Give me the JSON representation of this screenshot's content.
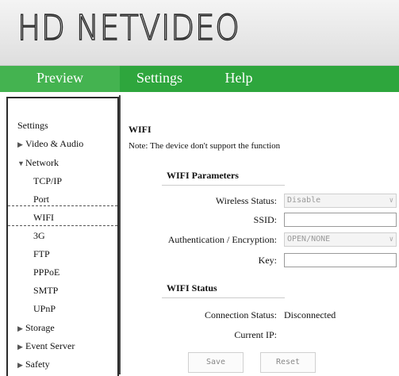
{
  "header": {
    "logo_text": "HD NETVIDEO"
  },
  "nav": {
    "preview": "Preview",
    "settings": "Settings",
    "help": "Help"
  },
  "sidebar": {
    "settings": "Settings",
    "video_audio": "Video & Audio",
    "network": "Network",
    "tcpip": "TCP/IP",
    "port": "Port",
    "wifi": "WIFI",
    "g3": "3G",
    "ftp": "FTP",
    "pppoe": "PPPoE",
    "smtp": "SMTP",
    "upnp": "UPnP",
    "storage": "Storage",
    "event_server": "Event Server",
    "safety": "Safety",
    "selected": "WIFI"
  },
  "main": {
    "title": "WIFI",
    "note": "Note: The device don't support the function",
    "params_heading": "WIFI Parameters",
    "wireless_status_label": "Wireless Status:",
    "wireless_status_value": "Disable",
    "ssid_label": "SSID:",
    "ssid_value": "",
    "auth_label": "Authentication / Encryption:",
    "auth_value": "OPEN/NONE",
    "key_label": "Key:",
    "key_value": "",
    "status_heading": "WIFI Status",
    "connection_label": "Connection Status:",
    "connection_value": "Disconnected",
    "ip_label": "Current IP:",
    "ip_value": "",
    "save": "Save",
    "reset": "Reset"
  },
  "icons": {
    "collapsed": "triangle-right-icon",
    "expanded": "triangle-down-icon",
    "dropdown": "chevron-down-icon"
  },
  "colors": {
    "nav_green": "#2ea63d",
    "nav_active_green": "#44b350"
  }
}
